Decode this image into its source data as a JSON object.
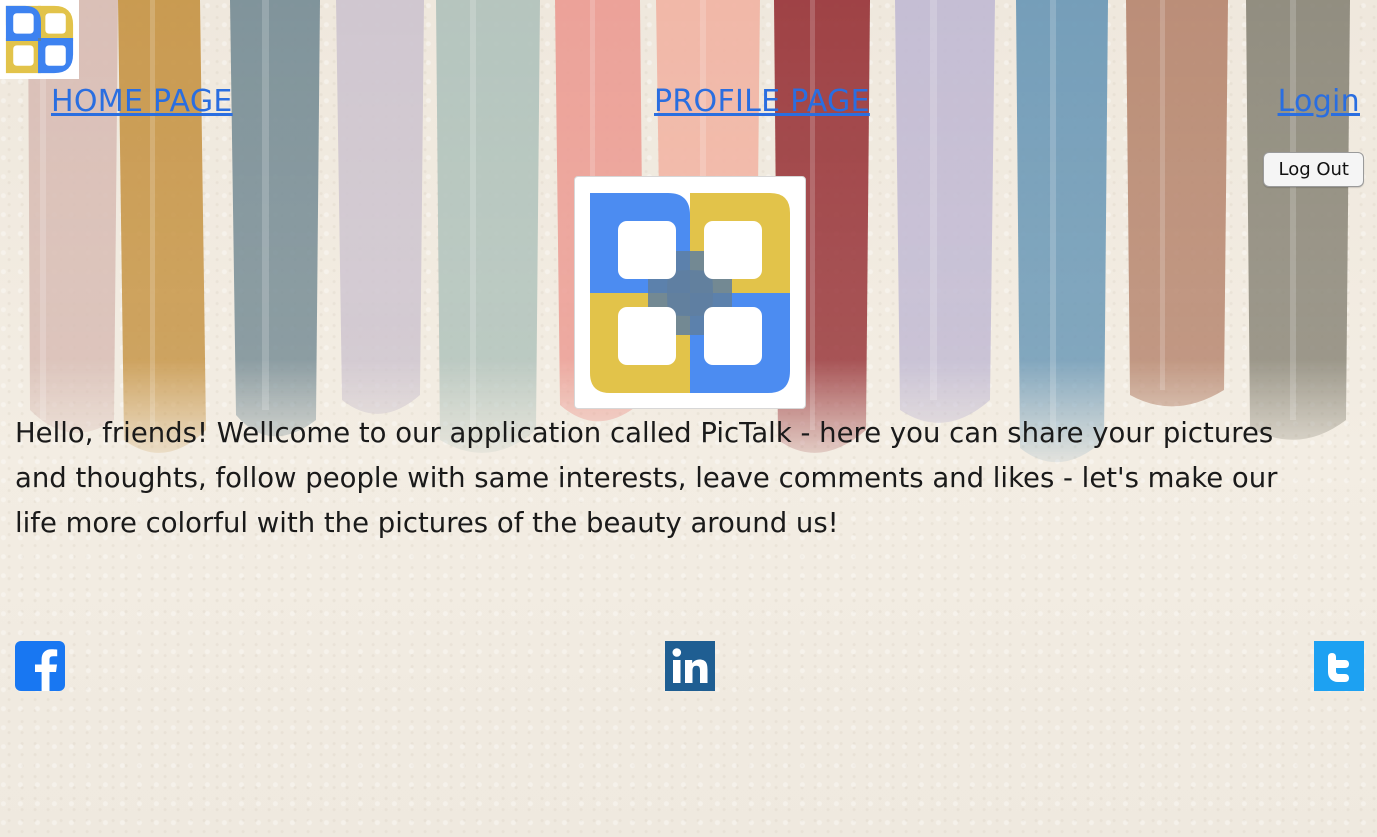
{
  "nav": {
    "home": "HOME PAGE",
    "profile": "PROFILE PAGE",
    "login": "Login"
  },
  "logout_label": "Log Out",
  "intro": "Hello, friends! Wellcome to our application called PicTalk - here you can share your pictures and thoughts, follow people with same interests, leave comments and likes - let's make our life more colorful with the pictures of the beauty around us!",
  "icons": {
    "logo_small": "app-logo-icon",
    "logo_main": "app-logo-icon",
    "facebook": "facebook-icon",
    "linkedin": "linkedin-icon",
    "twitter": "twitter-icon"
  },
  "colors": {
    "link": "#2a6ee0",
    "logo_blue": "#3d82f0",
    "logo_yellow": "#e2c34a",
    "logo_overlap": "#5f7fa0",
    "facebook": "#1877f2",
    "linkedin": "#1f5e92",
    "twitter": "#1da1f2",
    "text": "#1a1a1a"
  }
}
